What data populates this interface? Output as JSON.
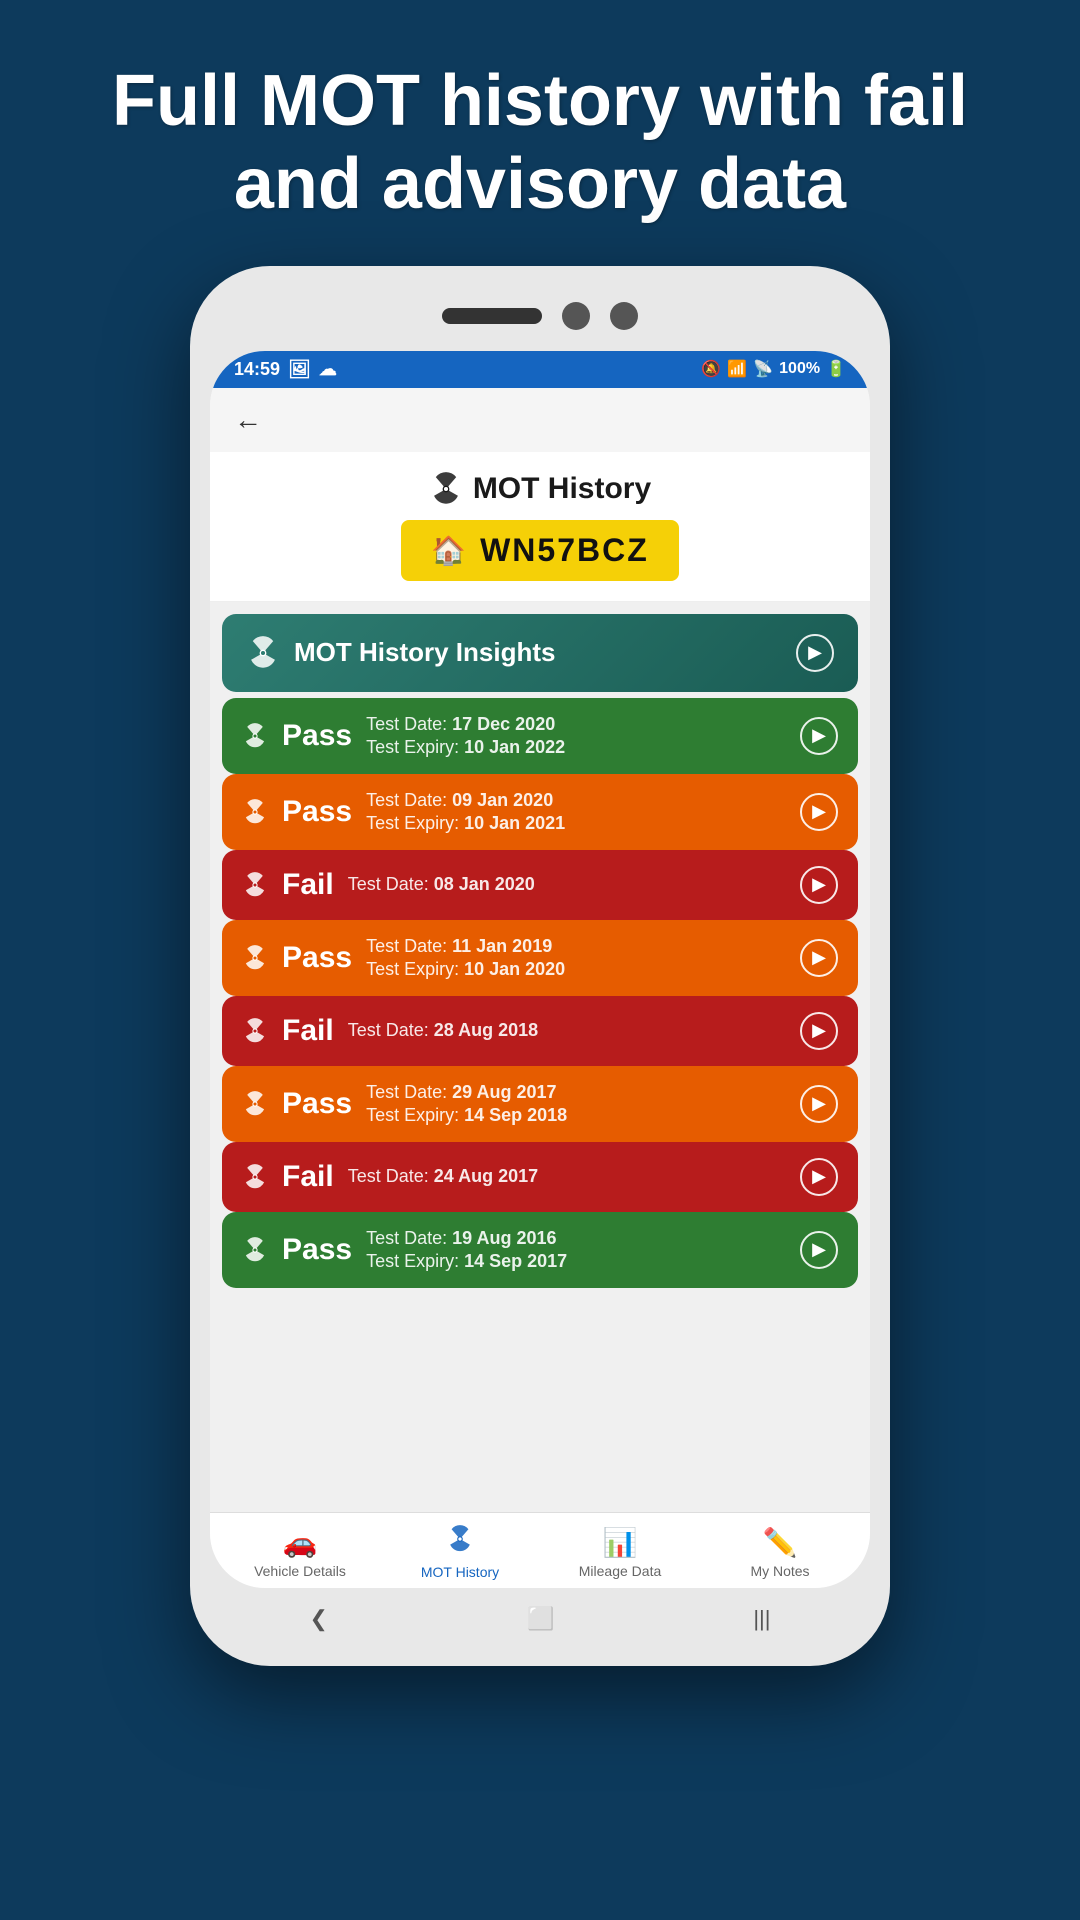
{
  "headline": "Full MOT history with fail and advisory data",
  "status_bar": {
    "time": "14:59",
    "battery": "100%"
  },
  "page_title": "MOT History",
  "plate": "WN57BCZ",
  "insights": {
    "label": "MOT History Insights"
  },
  "mot_records": [
    {
      "result": "Pass",
      "color": "pass-green",
      "test_date_label": "Test Date:",
      "test_date": "17 Dec 2020",
      "expiry_label": "Test Expiry:",
      "expiry": "10 Jan 2022"
    },
    {
      "result": "Pass",
      "color": "pass-orange",
      "test_date_label": "Test Date:",
      "test_date": "09 Jan 2020",
      "expiry_label": "Test Expiry:",
      "expiry": "10 Jan 2021"
    },
    {
      "result": "Fail",
      "color": "fail-red",
      "test_date_label": "Test Date:",
      "test_date": "08 Jan 2020",
      "expiry_label": "",
      "expiry": ""
    },
    {
      "result": "Pass",
      "color": "pass-orange",
      "test_date_label": "Test Date:",
      "test_date": "11 Jan 2019",
      "expiry_label": "Test Expiry:",
      "expiry": "10 Jan 2020"
    },
    {
      "result": "Fail",
      "color": "fail-red",
      "test_date_label": "Test Date:",
      "test_date": "28 Aug 2018",
      "expiry_label": "",
      "expiry": ""
    },
    {
      "result": "Pass",
      "color": "pass-orange",
      "test_date_label": "Test Date:",
      "test_date": "29 Aug 2017",
      "expiry_label": "Test Expiry:",
      "expiry": "14 Sep 2018"
    },
    {
      "result": "Fail",
      "color": "fail-red",
      "test_date_label": "Test Date:",
      "test_date": "24 Aug 2017",
      "expiry_label": "",
      "expiry": ""
    },
    {
      "result": "Pass",
      "color": "pass-green",
      "test_date_label": "Test Date:",
      "test_date": "19 Aug 2016",
      "expiry_label": "Test Expiry:",
      "expiry": "14 Sep 2017"
    }
  ],
  "bottom_nav": {
    "items": [
      {
        "label": "Vehicle Details",
        "icon": "car",
        "active": false
      },
      {
        "label": "MOT History",
        "icon": "radiation",
        "active": true
      },
      {
        "label": "Mileage Data",
        "icon": "chart",
        "active": false
      },
      {
        "label": "My Notes",
        "icon": "pencil",
        "active": false
      }
    ]
  }
}
